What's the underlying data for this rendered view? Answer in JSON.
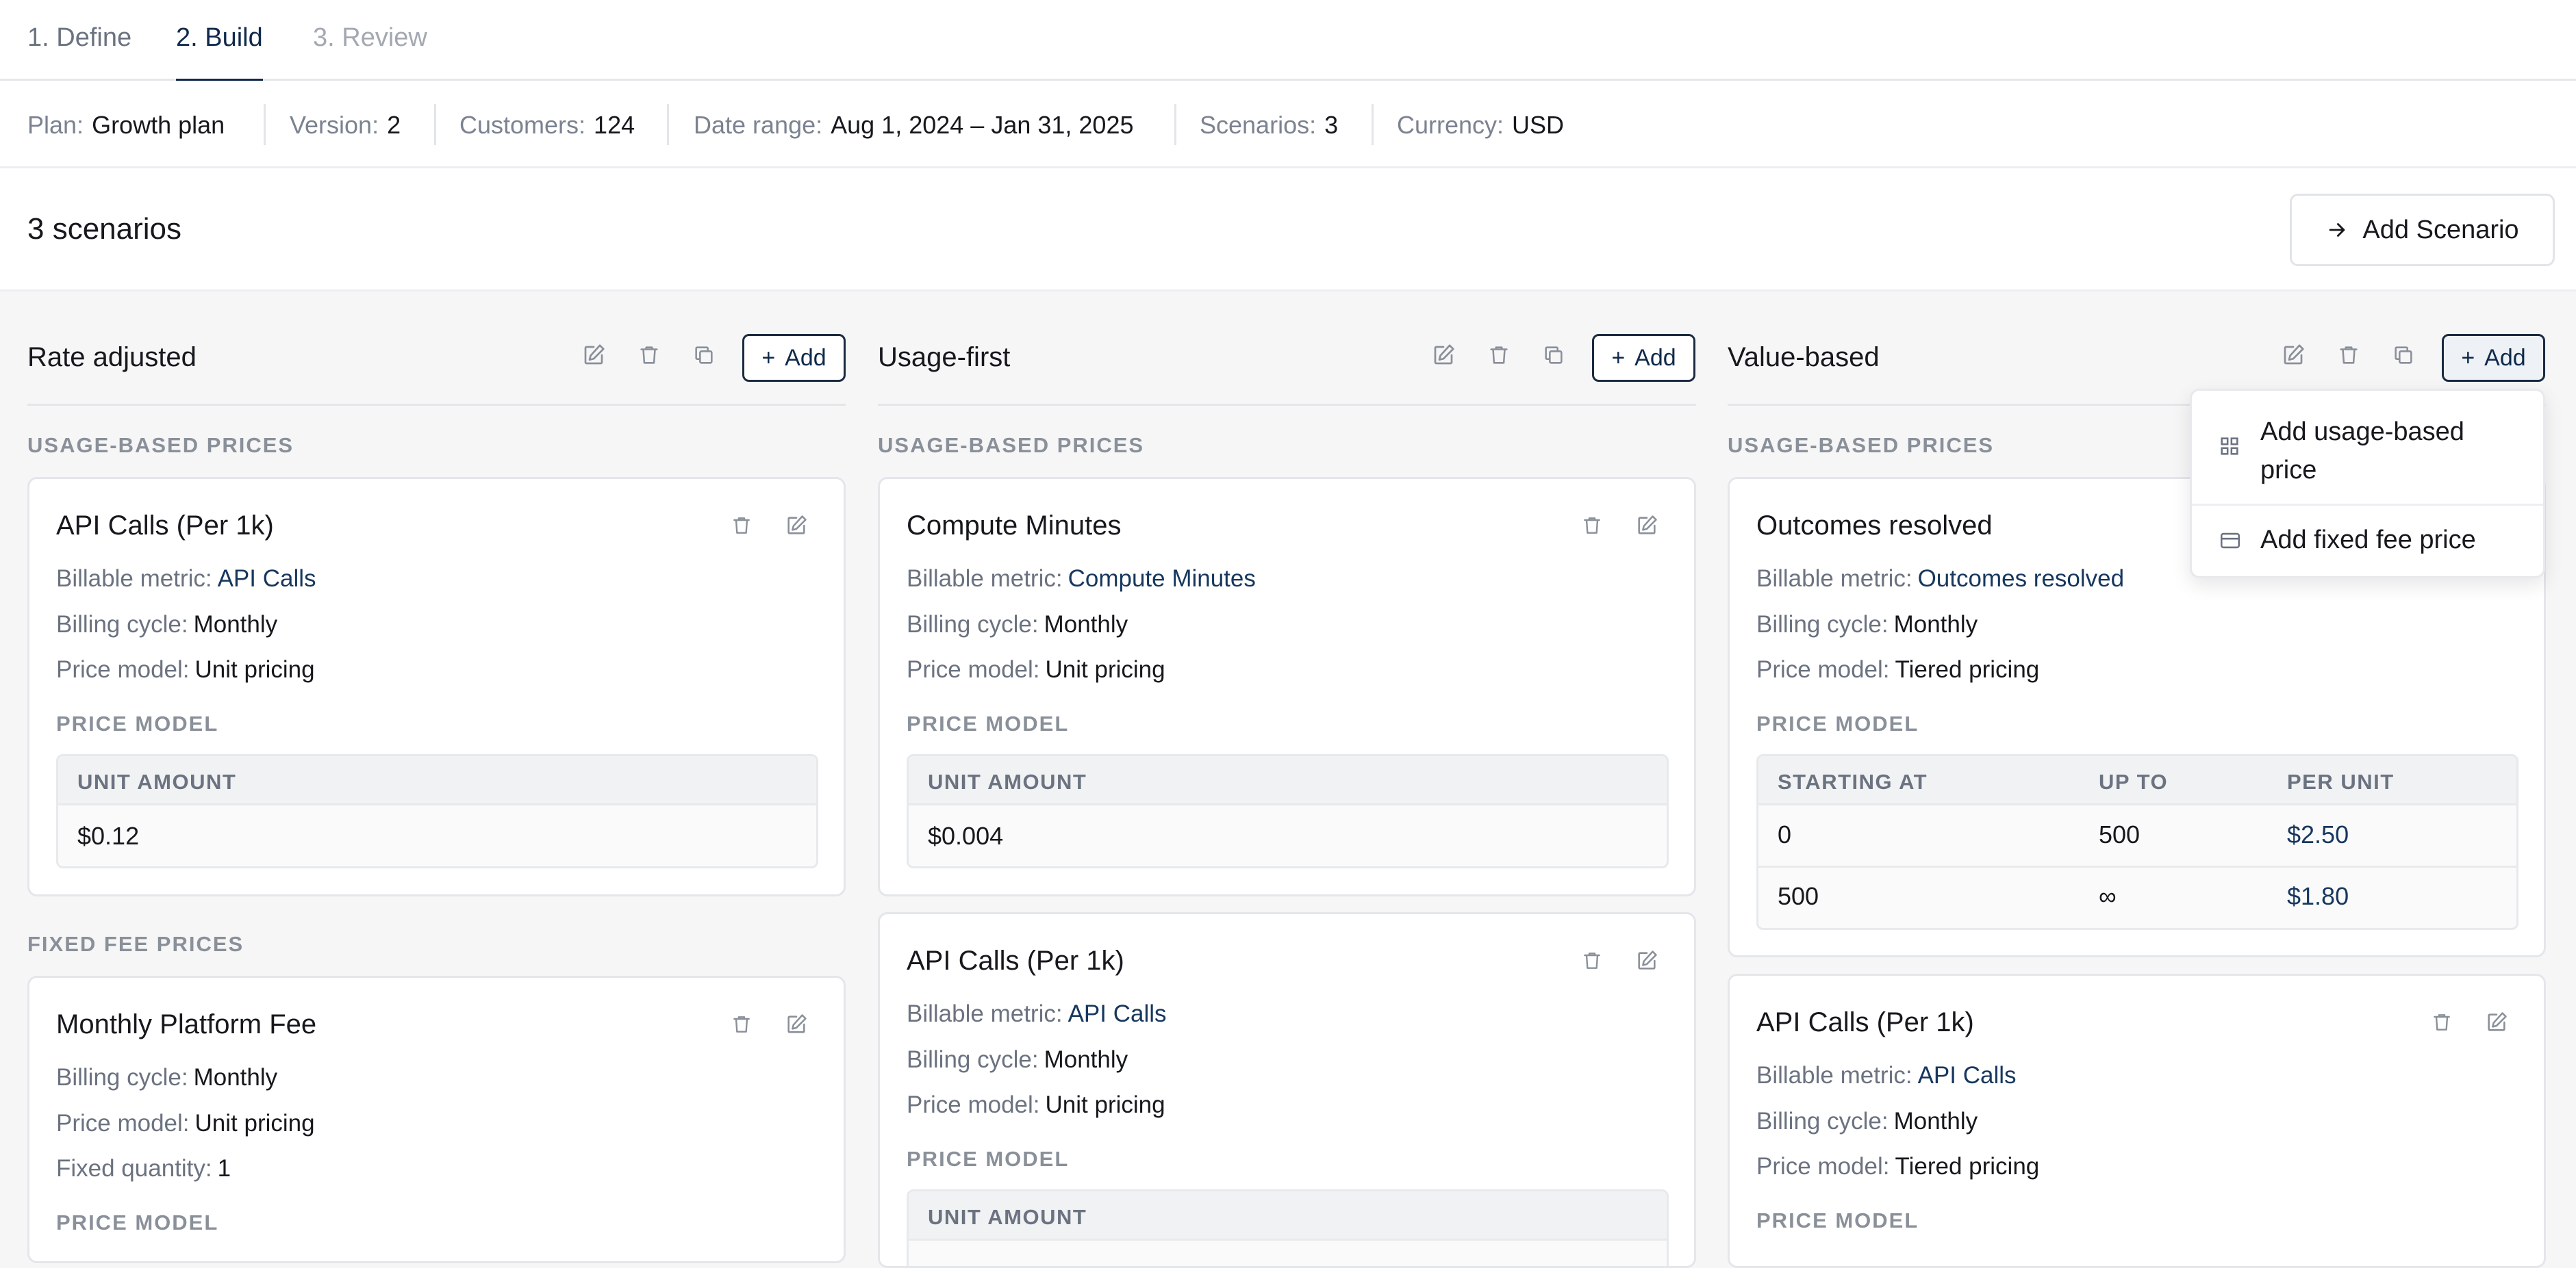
{
  "tabs": [
    {
      "label": "1. Define",
      "state": "default"
    },
    {
      "label": "2. Build",
      "state": "active"
    },
    {
      "label": "3. Review",
      "state": "disabled"
    }
  ],
  "info": {
    "plan": {
      "key": "Plan:",
      "value": "Growth plan"
    },
    "version": {
      "key": "Version:",
      "value": "2"
    },
    "customers": {
      "key": "Customers:",
      "value": "124"
    },
    "date_range": {
      "key": "Date range:",
      "value": "Aug 1, 2024 – Jan 31, 2025"
    },
    "scenarios": {
      "key": "Scenarios:",
      "value": "3"
    },
    "currency": {
      "key": "Currency:",
      "value": "USD"
    }
  },
  "header": {
    "scenario_count": "3 scenarios",
    "add_scenario": "Add Scenario"
  },
  "labels": {
    "usage_based": "USAGE-BASED PRICES",
    "fixed_fee": "FIXED FEE PRICES",
    "price_model": "PRICE MODEL",
    "unit_amount": "UNIT AMOUNT",
    "starting_at": "STARTING AT",
    "up_to": "UP TO",
    "per_unit": "PER UNIT",
    "add": "Add",
    "billable_metric": "Billable metric:",
    "billing_cycle": "Billing cycle:",
    "price_model_key": "Price model:",
    "fixed_quantity": "Fixed quantity:"
  },
  "columns": [
    {
      "title": "Rate adjusted",
      "cards": [
        {
          "title": "API Calls (Per 1k)",
          "metric": "API Calls",
          "cycle": "Monthly",
          "model": "Unit pricing",
          "unit_amount": "$0.12"
        },
        {
          "title": "Monthly Platform Fee",
          "cycle": "Monthly",
          "model": "Unit pricing",
          "quantity": "1"
        }
      ]
    },
    {
      "title": "Usage-first",
      "cards": [
        {
          "title": "Compute Minutes",
          "metric": "Compute Minutes",
          "cycle": "Monthly",
          "model": "Unit pricing",
          "unit_amount": "$0.004"
        },
        {
          "title": "API Calls (Per 1k)",
          "metric": "API Calls",
          "cycle": "Monthly",
          "model": "Unit pricing"
        }
      ]
    },
    {
      "title": "Value-based",
      "cards": [
        {
          "title": "Outcomes resolved",
          "metric": "Outcomes resolved",
          "cycle": "Monthly",
          "model": "Tiered pricing",
          "tiers": [
            {
              "start": "0",
              "up_to": "500",
              "per_unit": "$2.50"
            },
            {
              "start": "500",
              "up_to": "∞",
              "per_unit": "$1.80"
            }
          ]
        },
        {
          "title": "API Calls (Per 1k)",
          "metric": "API Calls",
          "cycle": "Monthly",
          "model": "Tiered pricing"
        }
      ]
    }
  ],
  "menu": {
    "usage": "Add usage-based price",
    "usage_line1": "Add usage-based",
    "usage_line2": "price",
    "fixed": "Add fixed fee price"
  },
  "colors": {
    "accent": "#0f2a4a",
    "link": "#17375e",
    "muted": "#6b7280"
  }
}
